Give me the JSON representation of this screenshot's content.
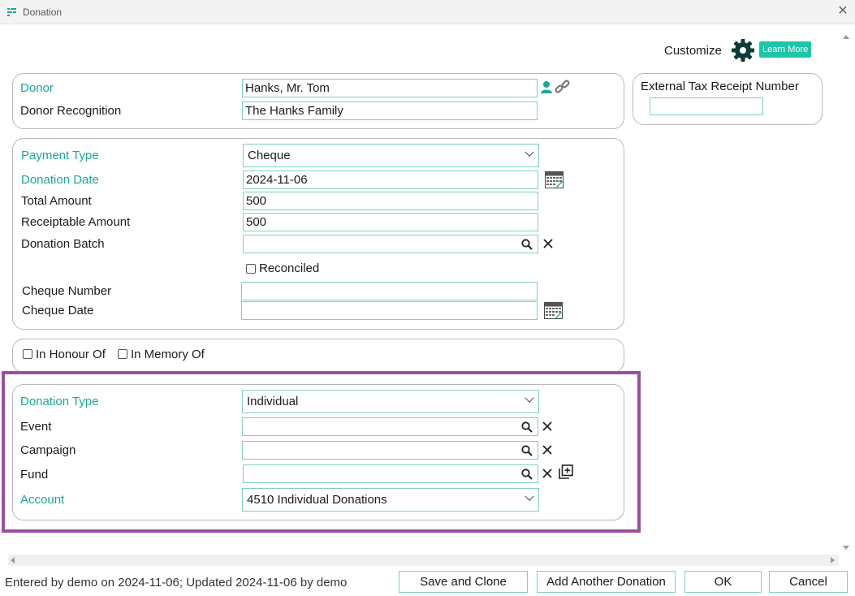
{
  "window": {
    "title": "Donation",
    "close_label": "✕"
  },
  "customize": {
    "label": "Customize",
    "learn_more": "Learn More"
  },
  "donor_section": {
    "donor_label": "Donor",
    "donor_value": "Hanks, Mr. Tom",
    "recognition_label": "Donor Recognition",
    "recognition_value": "The Hanks Family"
  },
  "tax_receipt": {
    "label": "External Tax Receipt Number",
    "value": ""
  },
  "payment_section": {
    "payment_type_label": "Payment Type",
    "payment_type_value": "Cheque",
    "donation_date_label": "Donation Date",
    "donation_date_value": "2024-11-06",
    "total_amount_label": "Total Amount",
    "total_amount_value": "500",
    "receiptable_label": "Receiptable Amount",
    "receiptable_value": "500",
    "batch_label": "Donation Batch",
    "batch_value": "",
    "reconciled_label": "Reconciled",
    "cheque_number_label": "Cheque Number",
    "cheque_number_value": "",
    "cheque_date_label": "Cheque Date",
    "cheque_date_value": ""
  },
  "honour_section": {
    "honour_label": "In Honour Of",
    "memory_label": "In Memory Of"
  },
  "type_section": {
    "donation_type_label": "Donation Type",
    "donation_type_value": "Individual",
    "event_label": "Event",
    "event_value": "",
    "campaign_label": "Campaign",
    "campaign_value": "",
    "fund_label": "Fund",
    "fund_value": "",
    "account_label": "Account",
    "account_value": "4510 Individual Donations"
  },
  "footer": {
    "status": "Entered by demo on 2024-11-06; Updated 2024-11-06 by demo",
    "save_clone": "Save and Clone",
    "add_another": "Add Another Donation",
    "ok": "OK",
    "cancel": "Cancel"
  },
  "colors": {
    "accent": "#1aa795",
    "field_border": "#7fcfc2",
    "highlight": "#9b4fa0"
  }
}
